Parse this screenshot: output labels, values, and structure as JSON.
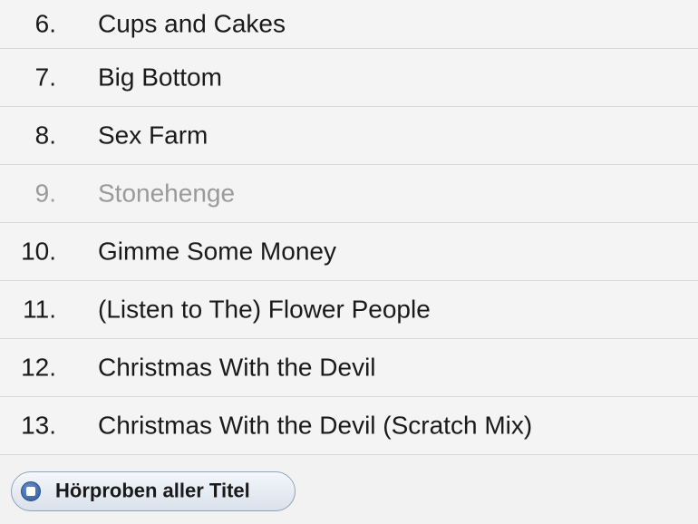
{
  "tracks": [
    {
      "number": "6.",
      "title": "Cups and Cakes",
      "available": true
    },
    {
      "number": "7.",
      "title": "Big Bottom",
      "available": true
    },
    {
      "number": "8.",
      "title": "Sex Farm",
      "available": true
    },
    {
      "number": "9.",
      "title": "Stonehenge",
      "available": false
    },
    {
      "number": "10.",
      "title": "Gimme Some Money",
      "available": true
    },
    {
      "number": "11.",
      "title": "(Listen to The) Flower People",
      "available": true
    },
    {
      "number": "12.",
      "title": "Christmas With the Devil",
      "available": true
    },
    {
      "number": "13.",
      "title": "Christmas With the Devil (Scratch Mix)",
      "available": true
    }
  ],
  "footer": {
    "preview_all_label": "Hörproben aller Titel",
    "preview_icon": "stop-icon"
  },
  "colors": {
    "row_background": "#f4f4f4",
    "divider": "#d8d8d8",
    "text": "#1a1a1a",
    "disabled_text": "#9a9a9a",
    "button_border": "#8fa0b8",
    "icon_blue": "#2e5a9e"
  }
}
